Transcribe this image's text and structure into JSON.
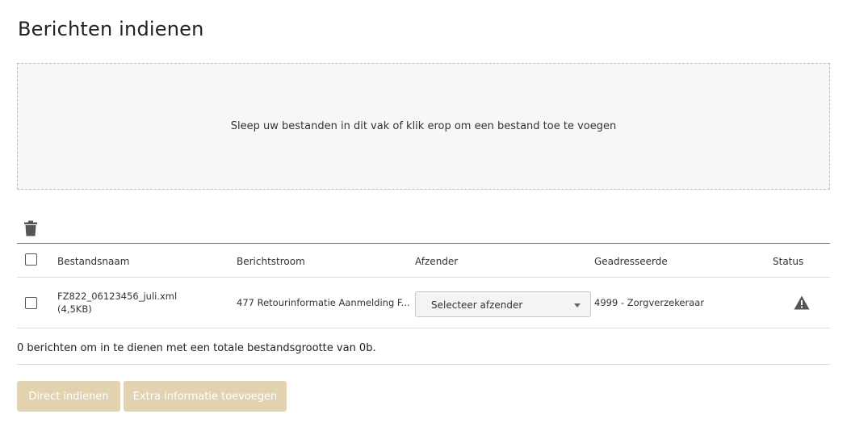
{
  "page": {
    "title": "Berichten indienen"
  },
  "dropzone": {
    "text": "Sleep uw bestanden in dit vak of klik erop om een bestand toe te voegen"
  },
  "table": {
    "columns": [
      "Bestandsnaam",
      "Berichtstroom",
      "Afzender",
      "Geadresseerde",
      "Status"
    ],
    "rows": [
      {
        "filename": "FZ822_06123456_juli.xml",
        "filesize": "(4,5KB)",
        "berichtstroom": "477 Retourinformatie Aanmelding F...",
        "afzender_placeholder": "Selecteer afzender",
        "geadresseerde": "4999 - Zorgverzekeraar",
        "status_icon": "warning-icon"
      }
    ]
  },
  "summary": {
    "text": "0 berichten om in te dienen met een totale bestandsgrootte van 0b."
  },
  "buttons": {
    "direct": "Direct indienen",
    "extra": "Extra informatie toevoegen"
  },
  "colors": {
    "accent_line": "#3d7fb5",
    "button_disabled": "#e2d2b0",
    "dropzone_bg": "#f7f7f7"
  }
}
